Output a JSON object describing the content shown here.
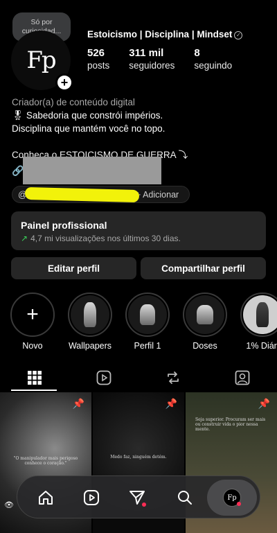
{
  "note": {
    "text": "Só por curiosidad..."
  },
  "avatar": {
    "monogram": "Fp",
    "add_label": "+"
  },
  "profile": {
    "username": "Estoicismo | Disciplina | Mindset",
    "verified_mark": "✓",
    "stats": [
      {
        "value": "526",
        "label": "posts"
      },
      {
        "value": "311 mil",
        "label": "seguidores"
      },
      {
        "value": "8",
        "label": "seguindo"
      }
    ]
  },
  "bio": {
    "category": "Criador(a) de conteúdo digital",
    "line1": "🎖 Sabedoria que constrói impérios.",
    "line2": "Disciplina que mantém você no topo.",
    "cta": "Conheça o ESTOICISMO DE GUERRA ⤵"
  },
  "threads": {
    "at_icon": "@",
    "add_label": "+ Adicionar"
  },
  "panel": {
    "title": "Painel profissional",
    "subtitle": "4,7 mi visualizações nos últimos 30 dias.",
    "trend_icon": "↗"
  },
  "buttons": {
    "edit": "Editar perfil",
    "share": "Compartilhar perfil"
  },
  "highlights": [
    {
      "label": "Novo"
    },
    {
      "label": "Wallpapers"
    },
    {
      "label": "Perfil 1"
    },
    {
      "label": "Doses"
    },
    {
      "label": "1% Diári"
    }
  ],
  "posts": [
    {
      "quote": "\"O manipulador mais perigoso conhece o coração.\""
    },
    {
      "quote": "Medo faz, ninguém detém."
    },
    {
      "quote": "Seja superior. Procuram ser mais ou construir vida o pior nessa mente."
    }
  ],
  "colors": {
    "accent_link": "#5b8cff",
    "trend_green": "#3ccf5a",
    "notification_red": "#ff2d55",
    "highlight_yellow": "#f2f20a"
  }
}
